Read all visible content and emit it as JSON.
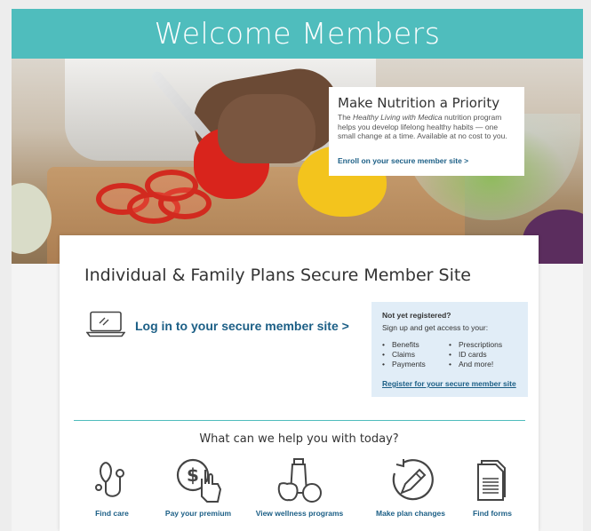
{
  "banner": {
    "title": "Welcome Members"
  },
  "promo": {
    "title": "Make Nutrition a Priority",
    "body_before": "The ",
    "body_program": "Healthy Living with Medica",
    "body_after": " nutrition program helps you develop lifelong healthy habits — one small change at a time. Available at no cost to you.",
    "link": "Enroll on your secure member site >"
  },
  "card": {
    "title": "Individual & Family Plans Secure Member Site",
    "login_label": "Log in to your secure member site >",
    "login_icon": "laptop-icon"
  },
  "register": {
    "heading": "Not yet registered?",
    "subheading": "Sign up and get access to your:",
    "col1": [
      "Benefits",
      "Claims",
      "Payments"
    ],
    "col2": [
      "Prescriptions",
      "ID cards",
      "And more!"
    ],
    "link": "Register for your secure member site"
  },
  "help": {
    "title": "What can we help you with today?",
    "items": [
      {
        "label": "Find care",
        "icon": "stethoscope-icon"
      },
      {
        "label": "Pay your premium",
        "icon": "dollar-hand-icon"
      },
      {
        "label": "View wellness programs",
        "icon": "wellness-icon"
      },
      {
        "label": "Make plan changes",
        "icon": "pencil-circle-icon"
      },
      {
        "label": "Find forms",
        "icon": "documents-icon"
      }
    ]
  },
  "colors": {
    "teal": "#4fbdbd",
    "link_blue": "#1c5f86",
    "panel_blue": "#e1edf7"
  }
}
